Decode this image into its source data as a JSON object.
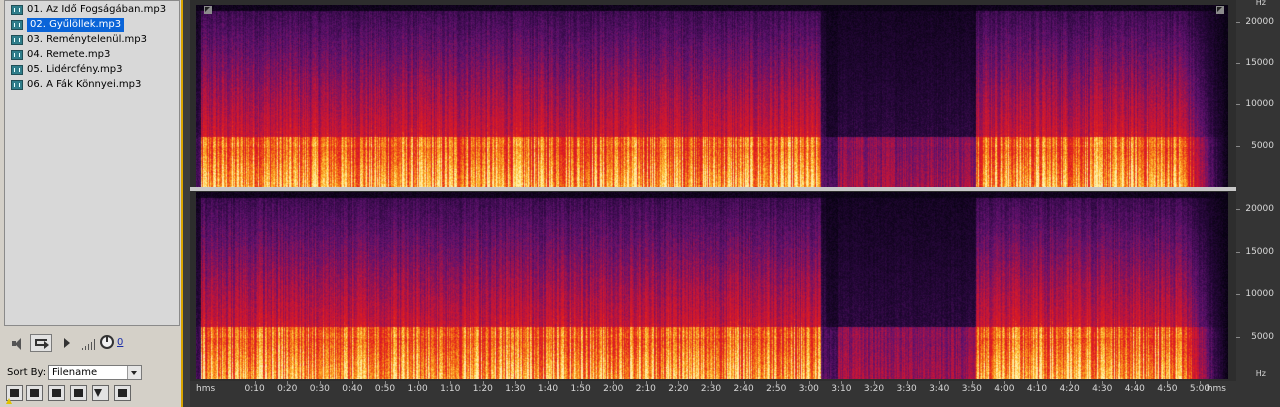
{
  "file_list": {
    "items": [
      {
        "label": "01. Az Idő Fogságában.mp3",
        "selected": false
      },
      {
        "label": "02. Gyűlöllek.mp3",
        "selected": true
      },
      {
        "label": "03. Reménytelenül.mp3",
        "selected": false
      },
      {
        "label": "04. Remete.mp3",
        "selected": false
      },
      {
        "label": "05. Lidércfény.mp3",
        "selected": false
      },
      {
        "label": "06. A Fák Könnyei.mp3",
        "selected": false
      }
    ],
    "icon": "audio-file-icon"
  },
  "transport": {
    "volume_value": "0",
    "icons": [
      "speaker-icon",
      "loop-icon",
      "play-icon",
      "volume-bars-icon",
      "volume-knob-icon"
    ]
  },
  "sort": {
    "label": "Sort By:",
    "selected": "Filename"
  },
  "bottom_tools": {
    "icons": [
      "insert-icon",
      "record-icon",
      "stop-icon",
      "music-icon",
      "filter-icon",
      "preview-icon"
    ]
  },
  "frequency_axis": {
    "unit": "Hz",
    "labels": [
      "20000",
      "15000",
      "10000",
      "5000"
    ]
  },
  "time_ruler": {
    "unit_left": "hms",
    "unit_right": "hms",
    "labels": [
      "0:10",
      "0:20",
      "0:30",
      "0:40",
      "0:50",
      "1:00",
      "1:10",
      "1:20",
      "1:30",
      "1:40",
      "1:50",
      "2:00",
      "2:10",
      "2:20",
      "2:30",
      "2:40",
      "2:50",
      "3:00",
      "3:10",
      "3:20",
      "3:30",
      "3:40",
      "3:50",
      "4:00",
      "4:10",
      "4:20",
      "4:30",
      "4:40",
      "4:50",
      "5:00"
    ]
  },
  "colors": {
    "selection": "#0a64d8",
    "panel_border": "#d9a400",
    "spectrum_low": "#1a0428",
    "spectrum_mid": "#c4122e",
    "spectrum_high": "#ffe070"
  }
}
